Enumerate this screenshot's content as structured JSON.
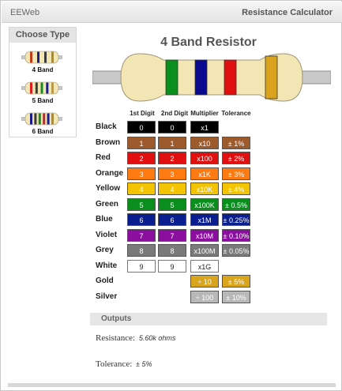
{
  "header": {
    "brand": "EEWeb",
    "title": "Resistance Calculator"
  },
  "sidebar": {
    "title": "Choose Type",
    "items": [
      {
        "label": "4 Band",
        "bands": [
          "#c43b19",
          "#1d1d8a",
          "#3b3b3b",
          "#b08a2a"
        ]
      },
      {
        "label": "5 Band",
        "bands": [
          "#e11c1c",
          "#3b3b3b",
          "#1a8a26",
          "#1d1d8a",
          "#c29a33"
        ]
      },
      {
        "label": "6 Band",
        "bands": [
          "#1d1d8a",
          "#3b3b3b",
          "#1a8a26",
          "#a33",
          "#1d1d8a",
          "#b08a2a"
        ]
      }
    ]
  },
  "main": {
    "title": "4 Band Resistor",
    "resistor_bands": [
      "#0a8f1f",
      "#0a0a8f",
      "#e01010",
      "#dba31c"
    ]
  },
  "columns": [
    "1st Digit",
    "2nd Digit",
    "Multiplier",
    "Tolerance"
  ],
  "rows": [
    {
      "name": "Black",
      "color": "#000000",
      "digit": "0",
      "multiplier": "x1",
      "tolerance": ""
    },
    {
      "name": "Brown",
      "color": "#9c5a2d",
      "digit": "1",
      "multiplier": "x10",
      "tolerance": "± 1%"
    },
    {
      "name": "Red",
      "color": "#e01010",
      "digit": "2",
      "multiplier": "x100",
      "tolerance": "± 2%"
    },
    {
      "name": "Orange",
      "color": "#ff7a10",
      "digit": "3",
      "multiplier": "x1K",
      "tolerance": "± 3%"
    },
    {
      "name": "Yellow",
      "color": "#f5c400",
      "digit": "4",
      "multiplier": "x10K",
      "tolerance": "± 4%"
    },
    {
      "name": "Green",
      "color": "#0a8f1f",
      "digit": "5",
      "multiplier": "x100K",
      "tolerance": "± 0.5%"
    },
    {
      "name": "Blue",
      "color": "#0a1f8f",
      "digit": "6",
      "multiplier": "x1M",
      "tolerance": "± 0.25%"
    },
    {
      "name": "Violet",
      "color": "#8a0f9e",
      "digit": "7",
      "multiplier": "x10M",
      "tolerance": "± 0.10%"
    },
    {
      "name": "Grey",
      "color": "#7a7a7a",
      "digit": "8",
      "multiplier": "x100M",
      "tolerance": "± 0.05%"
    },
    {
      "name": "White",
      "color": "#ffffff",
      "digit": "9",
      "multiplier": "x1G",
      "tolerance": ""
    },
    {
      "name": "Gold",
      "color": "#d9a51c",
      "digit": "",
      "multiplier": "÷ 10",
      "tolerance": "± 5%"
    },
    {
      "name": "Silver",
      "color": "#b8b8b8",
      "digit": "",
      "multiplier": "÷ 100",
      "tolerance": "± 10%"
    }
  ],
  "outputs": {
    "title": "Outputs",
    "resistance_label": "Resistance:",
    "resistance_value": "5.60k ohms",
    "tolerance_label": "Tolerance:",
    "tolerance_value": "± 5%"
  }
}
